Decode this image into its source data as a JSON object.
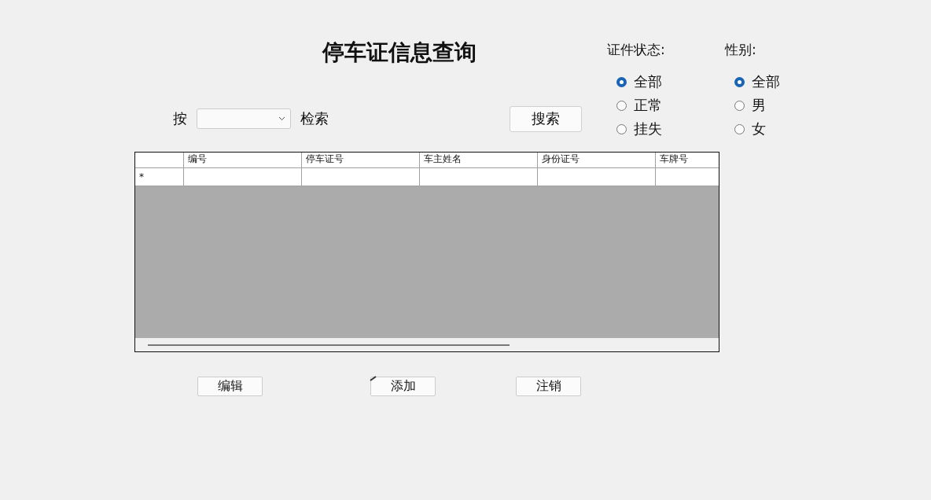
{
  "title": "停车证信息查询",
  "search": {
    "label_before": "按",
    "label_after": "检索",
    "button": "搜索"
  },
  "radio_groups": [
    {
      "title": "证件状态:",
      "options": [
        {
          "label": "全部",
          "selected": true
        },
        {
          "label": "正常",
          "selected": false
        },
        {
          "label": "挂失",
          "selected": false
        }
      ]
    },
    {
      "title": "性别:",
      "options": [
        {
          "label": "全部",
          "selected": true
        },
        {
          "label": "男",
          "selected": false
        },
        {
          "label": "女",
          "selected": false
        }
      ]
    }
  ],
  "table": {
    "columns": [
      "编号",
      "停车证号",
      "车主姓名",
      "身份证号",
      "车牌号"
    ],
    "new_row_marker": "*"
  },
  "buttons": [
    "编辑",
    "添加",
    "注销"
  ]
}
